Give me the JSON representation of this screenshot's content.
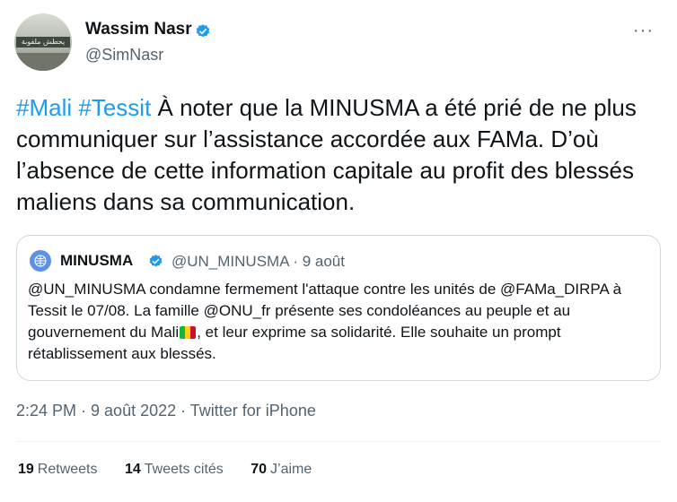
{
  "author": {
    "name": "Wassim Nasr",
    "handle": "@SimNasr",
    "avatar_text": "يحطش ملفوبة"
  },
  "more_label": "···",
  "tweet": {
    "hashtag1": "#Mali",
    "hashtag2": "#Tessit",
    "body": " À noter que la MINUSMA a été prié de ne plus communiquer sur l’assistance accordée aux FAMa. D’où l’absence de cette information capitale au profit des blessés maliens dans sa communication."
  },
  "quoted": {
    "name": "MINUSMA",
    "handle": "@UN_MINUSMA",
    "date": "9 août",
    "text_part1": "@UN_MINUSMA condamne fermement l'attaque contre les unités de @FAMa_DIRPA à Tessit le 07/08. La famille @ONU_fr présente ses condoléances au peuple et au gouvernement du Mali",
    "text_part2": ", et leur exprime sa solidarité. Elle souhaite un prompt rétablissement aux blessés."
  },
  "timestamp": "2:24 PM · 9 août 2022 · Twitter for iPhone",
  "stats": {
    "retweets_count": "19",
    "retweets_label": "Retweets",
    "quotes_count": "14",
    "quotes_label": "Tweets cités",
    "likes_count": "70",
    "likes_label": "J’aime"
  },
  "colors": {
    "link": "#1d9bf0",
    "secondary_text": "#536471",
    "verified": "#1d9bf0"
  }
}
